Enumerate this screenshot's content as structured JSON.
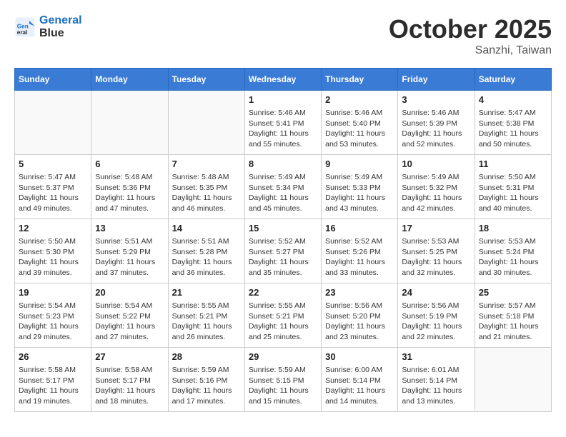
{
  "header": {
    "logo_line1": "General",
    "logo_line2": "Blue",
    "month_title": "October 2025",
    "location": "Sanzhi, Taiwan"
  },
  "days_of_week": [
    "Sunday",
    "Monday",
    "Tuesday",
    "Wednesday",
    "Thursday",
    "Friday",
    "Saturday"
  ],
  "weeks": [
    [
      {
        "day": "",
        "info": ""
      },
      {
        "day": "",
        "info": ""
      },
      {
        "day": "",
        "info": ""
      },
      {
        "day": "1",
        "info": "Sunrise: 5:46 AM\nSunset: 5:41 PM\nDaylight: 11 hours and 55 minutes."
      },
      {
        "day": "2",
        "info": "Sunrise: 5:46 AM\nSunset: 5:40 PM\nDaylight: 11 hours and 53 minutes."
      },
      {
        "day": "3",
        "info": "Sunrise: 5:46 AM\nSunset: 5:39 PM\nDaylight: 11 hours and 52 minutes."
      },
      {
        "day": "4",
        "info": "Sunrise: 5:47 AM\nSunset: 5:38 PM\nDaylight: 11 hours and 50 minutes."
      }
    ],
    [
      {
        "day": "5",
        "info": "Sunrise: 5:47 AM\nSunset: 5:37 PM\nDaylight: 11 hours and 49 minutes."
      },
      {
        "day": "6",
        "info": "Sunrise: 5:48 AM\nSunset: 5:36 PM\nDaylight: 11 hours and 47 minutes."
      },
      {
        "day": "7",
        "info": "Sunrise: 5:48 AM\nSunset: 5:35 PM\nDaylight: 11 hours and 46 minutes."
      },
      {
        "day": "8",
        "info": "Sunrise: 5:49 AM\nSunset: 5:34 PM\nDaylight: 11 hours and 45 minutes."
      },
      {
        "day": "9",
        "info": "Sunrise: 5:49 AM\nSunset: 5:33 PM\nDaylight: 11 hours and 43 minutes."
      },
      {
        "day": "10",
        "info": "Sunrise: 5:49 AM\nSunset: 5:32 PM\nDaylight: 11 hours and 42 minutes."
      },
      {
        "day": "11",
        "info": "Sunrise: 5:50 AM\nSunset: 5:31 PM\nDaylight: 11 hours and 40 minutes."
      }
    ],
    [
      {
        "day": "12",
        "info": "Sunrise: 5:50 AM\nSunset: 5:30 PM\nDaylight: 11 hours and 39 minutes."
      },
      {
        "day": "13",
        "info": "Sunrise: 5:51 AM\nSunset: 5:29 PM\nDaylight: 11 hours and 37 minutes."
      },
      {
        "day": "14",
        "info": "Sunrise: 5:51 AM\nSunset: 5:28 PM\nDaylight: 11 hours and 36 minutes."
      },
      {
        "day": "15",
        "info": "Sunrise: 5:52 AM\nSunset: 5:27 PM\nDaylight: 11 hours and 35 minutes."
      },
      {
        "day": "16",
        "info": "Sunrise: 5:52 AM\nSunset: 5:26 PM\nDaylight: 11 hours and 33 minutes."
      },
      {
        "day": "17",
        "info": "Sunrise: 5:53 AM\nSunset: 5:25 PM\nDaylight: 11 hours and 32 minutes."
      },
      {
        "day": "18",
        "info": "Sunrise: 5:53 AM\nSunset: 5:24 PM\nDaylight: 11 hours and 30 minutes."
      }
    ],
    [
      {
        "day": "19",
        "info": "Sunrise: 5:54 AM\nSunset: 5:23 PM\nDaylight: 11 hours and 29 minutes."
      },
      {
        "day": "20",
        "info": "Sunrise: 5:54 AM\nSunset: 5:22 PM\nDaylight: 11 hours and 27 minutes."
      },
      {
        "day": "21",
        "info": "Sunrise: 5:55 AM\nSunset: 5:21 PM\nDaylight: 11 hours and 26 minutes."
      },
      {
        "day": "22",
        "info": "Sunrise: 5:55 AM\nSunset: 5:21 PM\nDaylight: 11 hours and 25 minutes."
      },
      {
        "day": "23",
        "info": "Sunrise: 5:56 AM\nSunset: 5:20 PM\nDaylight: 11 hours and 23 minutes."
      },
      {
        "day": "24",
        "info": "Sunrise: 5:56 AM\nSunset: 5:19 PM\nDaylight: 11 hours and 22 minutes."
      },
      {
        "day": "25",
        "info": "Sunrise: 5:57 AM\nSunset: 5:18 PM\nDaylight: 11 hours and 21 minutes."
      }
    ],
    [
      {
        "day": "26",
        "info": "Sunrise: 5:58 AM\nSunset: 5:17 PM\nDaylight: 11 hours and 19 minutes."
      },
      {
        "day": "27",
        "info": "Sunrise: 5:58 AM\nSunset: 5:17 PM\nDaylight: 11 hours and 18 minutes."
      },
      {
        "day": "28",
        "info": "Sunrise: 5:59 AM\nSunset: 5:16 PM\nDaylight: 11 hours and 17 minutes."
      },
      {
        "day": "29",
        "info": "Sunrise: 5:59 AM\nSunset: 5:15 PM\nDaylight: 11 hours and 15 minutes."
      },
      {
        "day": "30",
        "info": "Sunrise: 6:00 AM\nSunset: 5:14 PM\nDaylight: 11 hours and 14 minutes."
      },
      {
        "day": "31",
        "info": "Sunrise: 6:01 AM\nSunset: 5:14 PM\nDaylight: 11 hours and 13 minutes."
      },
      {
        "day": "",
        "info": ""
      }
    ]
  ]
}
